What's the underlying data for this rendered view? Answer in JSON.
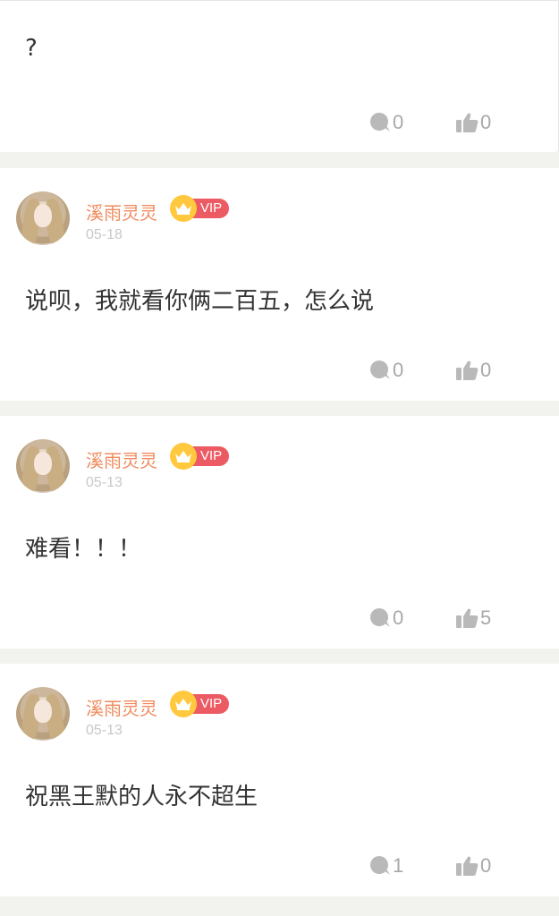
{
  "comments": [
    {
      "content": "?",
      "reply_count": "0",
      "like_count": "0"
    },
    {
      "username": "溪雨灵灵",
      "vip_label": "VIP",
      "date": "05-18",
      "content": "说呗，我就看你俩二百五，怎么说",
      "reply_count": "0",
      "like_count": "0"
    },
    {
      "username": "溪雨灵灵",
      "vip_label": "VIP",
      "date": "05-13",
      "content": "难看！！！",
      "reply_count": "0",
      "like_count": "5"
    },
    {
      "username": "溪雨灵灵",
      "vip_label": "VIP",
      "date": "05-13",
      "content": "祝黑王默的人永不超生",
      "reply_count": "1",
      "like_count": "0"
    }
  ],
  "icons": {
    "reply": "comment-bubble-icon",
    "like": "thumbs-up-icon",
    "vip": "crown-icon"
  },
  "colors": {
    "username": "#f08a5d",
    "vip_badge": "#ec5b63",
    "crown": "#ffc83d",
    "meta_gray": "#a8a8a8",
    "background": "#f2f2ee"
  }
}
